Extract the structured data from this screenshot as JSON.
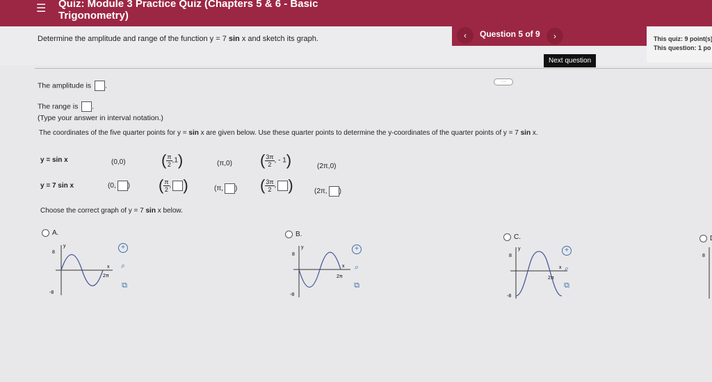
{
  "header": {
    "title_line1": "Quiz: Module 3 Practice Quiz (Chapters 5 & 6 - Basic",
    "title_line2": "Trigonometry)",
    "question_counter": "Question 5 of 9",
    "next_tooltip": "Next question",
    "score_quiz": "This quiz: 9 point(s)",
    "score_question": "This question: 1 po"
  },
  "question": {
    "prompt_pre": "Determine the amplitude and range of the function y = 7 ",
    "prompt_bold": "sin",
    "prompt_post": " x and sketch its graph.",
    "amplitude_label": "The amplitude is",
    "range_label": "The range is",
    "range_hint": "(Type your answer in interval notation.)",
    "quarter_intro_pre": "The coordinates of the five quarter points for y = ",
    "quarter_intro_bold": "sin",
    "quarter_intro_post": " x are given below. Use these quarter points to determine the y-coordinates of the quarter points of y = 7 ",
    "quarter_intro_bold2": "sin",
    "quarter_intro_end": " x.",
    "choose_pre": "Choose the correct graph of y = 7 ",
    "choose_bold": "sin",
    "choose_post": " x below."
  },
  "table": {
    "row1_label": "y = sin x",
    "row2_label": "y = 7 sin x",
    "row1": {
      "p1": "(0,0)",
      "p2_num": "π",
      "p2_den": "2",
      "p2_y": ",1",
      "p3": "(π,0)",
      "p4_num": "3π",
      "p4_den": "2",
      "p4_y": ", - 1",
      "p5": "(2π,0)"
    },
    "row2": {
      "p1_pre": "(0,",
      "p2_num": "π",
      "p2_den": "2",
      "p3_pre": "(π,",
      "p4_num": "3π",
      "p4_den": "2",
      "p5_pre": "(2π,"
    }
  },
  "options": [
    {
      "letter": "A.",
      "y_top": "8",
      "y_bottom": "-8",
      "x_label": "x",
      "y_label": "y",
      "two_pi": "2π"
    },
    {
      "letter": "B.",
      "y_top": "8",
      "y_bottom": "-8",
      "x_label": "x",
      "y_label": "y",
      "two_pi": "2π"
    },
    {
      "letter": "C.",
      "y_top": "8",
      "y_bottom": "-8",
      "x_label": "x",
      "y_label": "y",
      "two_pi": "2π"
    },
    {
      "letter": "D.",
      "y_top": "8",
      "y_bottom": "",
      "x_label": "",
      "y_label": "",
      "two_pi": ""
    }
  ],
  "colors": {
    "header_bg": "#9c2744",
    "tool_blue": "#3d6fa8",
    "curve": "#4a5a9c"
  }
}
